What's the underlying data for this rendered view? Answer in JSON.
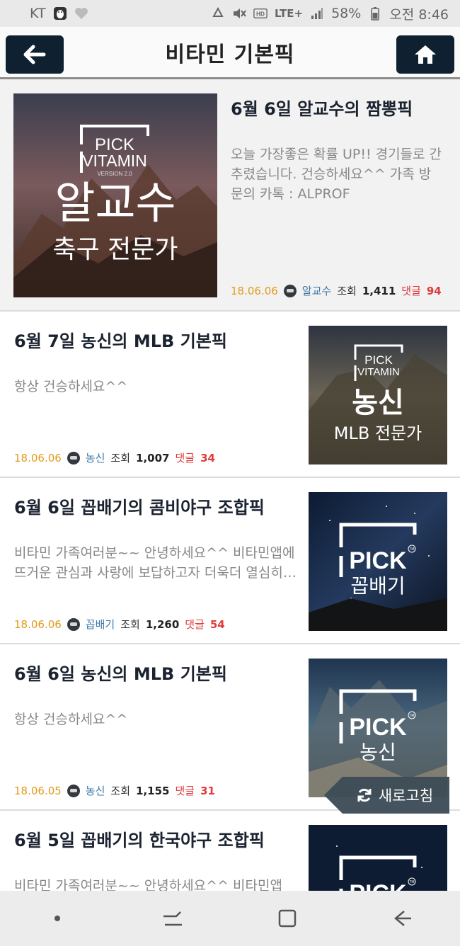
{
  "status_bar": {
    "carrier": "KT",
    "network": "LTE+",
    "battery": "58%",
    "time": "오전 8:46"
  },
  "header": {
    "title": "비타민 기본픽",
    "back_icon": "back-arrow-icon",
    "home_icon": "home-icon"
  },
  "posts": [
    {
      "title": "6월 6일 알교수의 짬뽕픽",
      "excerpt": "오늘 가장좋은 확률 UP!! 경기들로 간추렸습니다. 건승하세요^^ 가족 방문의 카톡 : ALPROF",
      "date": "18.06.06",
      "author": "알교수",
      "views_label": "조회",
      "views": "1,411",
      "comments_label": "댓글",
      "comments": "94",
      "thumb": {
        "brand_top": "PICK",
        "brand_bottom": "VITAMIN",
        "version": "VERSION 2.0",
        "name": "알교수",
        "subtitle": "축구 전문가"
      }
    },
    {
      "title": "6월 7일 농신의 MLB 기본픽",
      "excerpt": "항상 건승하세요^^",
      "date": "18.06.06",
      "author": "농신",
      "views_label": "조회",
      "views": "1,007",
      "comments_label": "댓글",
      "comments": "34",
      "thumb": {
        "brand_top": "PICK",
        "brand_bottom": "VITAMIN",
        "name": "농신",
        "subtitle": "MLB 전문가"
      }
    },
    {
      "title": "6월 6일 꼽배기의 콤비야구 조합픽",
      "excerpt": "비타민 가족여러분~~ 안녕하세요^^ 비타민앱에 뜨거운 관심과 사랑에 보답하고자 더욱더 열심히 분석하겠습니다",
      "date": "18.06.06",
      "author": "꼽배기",
      "views_label": "조회",
      "views": "1,260",
      "comments_label": "댓글",
      "comments": "54",
      "thumb": {
        "brand": "PICK",
        "tm": "TM",
        "name": "꼽배기"
      }
    },
    {
      "title": "6월 6일 농신의 MLB 기본픽",
      "excerpt": "항상 건승하세요^^",
      "date": "18.06.05",
      "author": "농신",
      "views_label": "조회",
      "views": "1,155",
      "comments_label": "댓글",
      "comments": "31",
      "thumb": {
        "brand": "PICK",
        "tm": "TM",
        "name": "농신"
      }
    },
    {
      "title": "6월 5일 꼽배기의 한국야구 조합픽",
      "excerpt": "비타민 가족여러분~~ 안녕하세요^^ 비타민앱",
      "thumb": {
        "brand": "PICK",
        "tm": "TM"
      }
    }
  ],
  "refresh_button": {
    "label": "새로고침",
    "icon": "refresh-icon"
  },
  "nav_bar": {
    "items": [
      "dot-icon",
      "recent-apps-icon",
      "home-square-icon",
      "back-icon"
    ]
  },
  "colors": {
    "header_button": "#0f2130",
    "date": "#e39a1d",
    "author": "#3b78a8",
    "comments": "#e03b3b",
    "refresh_bg": "#3e4d58"
  }
}
